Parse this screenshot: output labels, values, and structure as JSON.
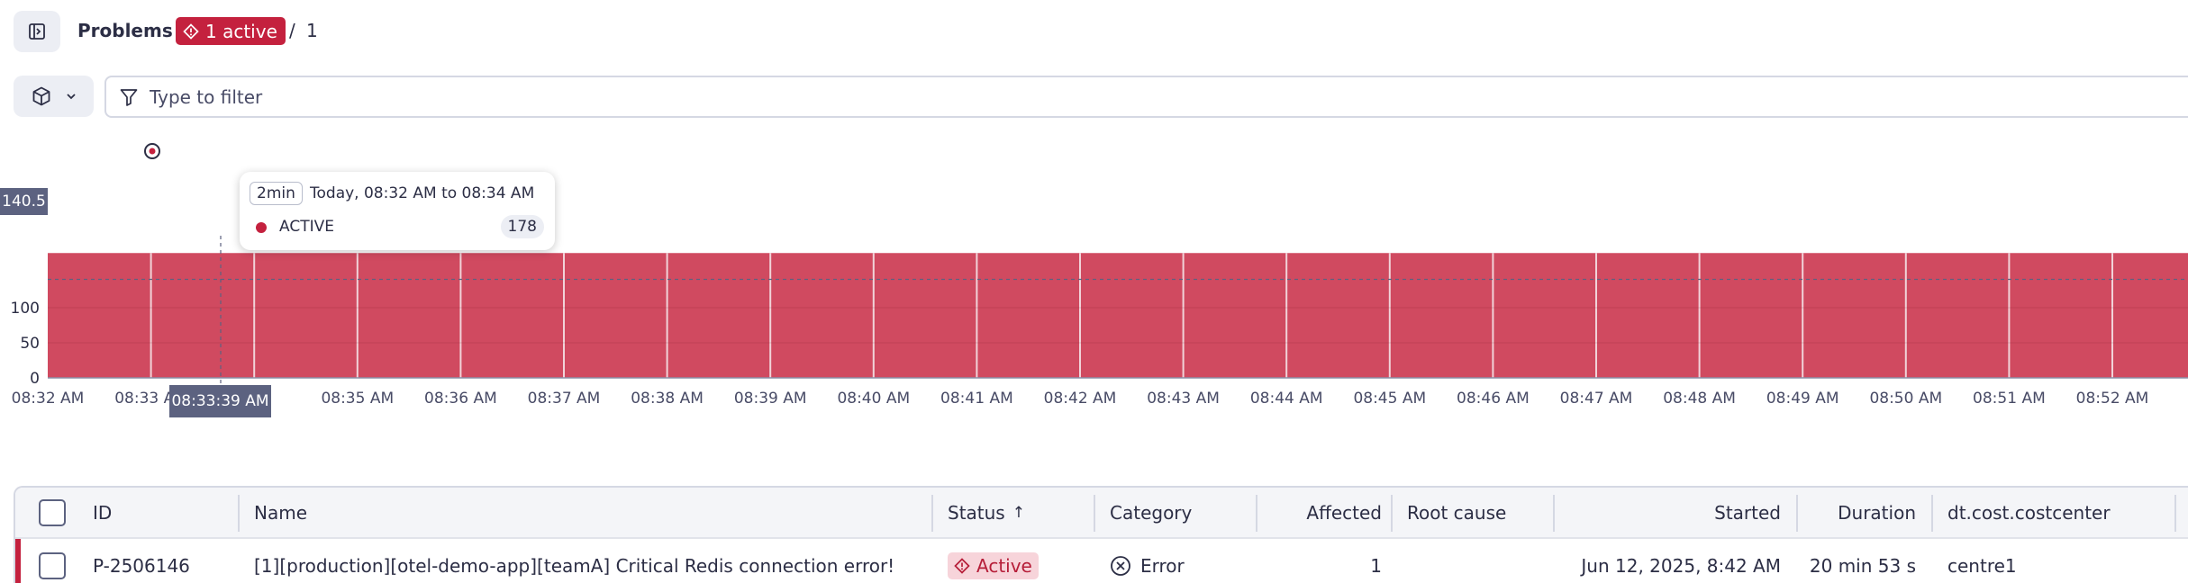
{
  "header": {
    "title": "Problems",
    "active_badge": "1 active",
    "separator": "/",
    "total": "1"
  },
  "filter": {
    "placeholder": "Type to filter"
  },
  "chart_data": {
    "type": "area",
    "title": "",
    "xlabel": "",
    "ylabel": "",
    "x": [
      "08:32 AM",
      "08:33 AM",
      "08:34 AM",
      "08:35 AM",
      "08:36 AM",
      "08:37 AM",
      "08:38 AM",
      "08:39 AM",
      "08:40 AM",
      "08:41 AM",
      "08:42 AM",
      "08:43 AM",
      "08:44 AM",
      "08:45 AM",
      "08:46 AM",
      "08:47 AM",
      "08:48 AM",
      "08:49 AM",
      "08:50 AM",
      "08:51 AM",
      "08:52 AM"
    ],
    "series": [
      {
        "name": "ACTIVE",
        "color": "#c4213e",
        "values": [
          178,
          178,
          178,
          178,
          178,
          178,
          178,
          178,
          178,
          178,
          178,
          178,
          178,
          178,
          178,
          178,
          178,
          178,
          178,
          178,
          178
        ]
      }
    ],
    "y_ticks": [
      "0",
      "50",
      "100"
    ],
    "ylim": [
      0,
      195
    ],
    "grid": true,
    "cursor": {
      "value": "140.5",
      "time": "08:33:39 AM"
    },
    "tooltip": {
      "duration": "2min",
      "range": "Today, 08:32 AM to 08:34 AM",
      "series_label": "ACTIVE",
      "value": "178"
    }
  },
  "table": {
    "columns": {
      "id": "ID",
      "name": "Name",
      "status": "Status",
      "status_sort": "↑",
      "category": "Category",
      "affected": "Affected",
      "root_cause": "Root cause",
      "started": "Started",
      "duration": "Duration",
      "costcenter": "dt.cost.costcenter"
    },
    "rows": [
      {
        "id": "P-2506146",
        "name": "[1][production][otel-demo-app][teamA] Critical Redis connection error!",
        "status": "Active",
        "category": "Error",
        "affected": "1",
        "root_cause": "",
        "started": "Jun 12, 2025, 8:42 AM",
        "duration": "20 min 53 s",
        "costcenter": "centre1"
      }
    ]
  },
  "colors": {
    "accent": "#c4213e",
    "chart_fill": "#d04a60",
    "badge_bg": "#f7d4da",
    "cursor_label_bg": "#5c6280"
  },
  "icons": {
    "sidebar_toggle": "panel-toggle-icon",
    "active_badge": "problem-diamond-icon",
    "entity_selector": "cube-icon",
    "filter": "funnel-icon",
    "status_active": "problem-diamond-icon",
    "category_error": "circle-x-icon"
  }
}
